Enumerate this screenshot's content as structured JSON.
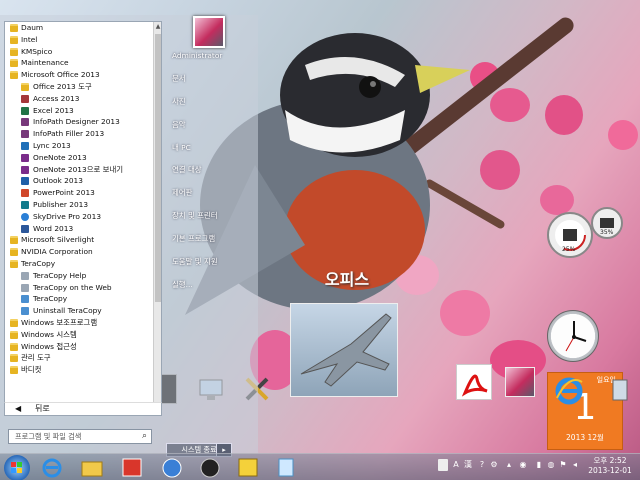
{
  "desktop": {
    "shortcut_label": "오피스"
  },
  "start_menu": {
    "programs": [
      {
        "label": "Daum"
      },
      {
        "label": "Intel"
      },
      {
        "label": "KMSpico"
      },
      {
        "label": "Maintenance"
      },
      {
        "label": "Microsoft Office 2013"
      },
      {
        "label": "Office 2013 도구"
      },
      {
        "label": "Access 2013"
      },
      {
        "label": "Excel 2013"
      },
      {
        "label": "InfoPath Designer 2013"
      },
      {
        "label": "InfoPath Filler 2013"
      },
      {
        "label": "Lync 2013"
      },
      {
        "label": "OneNote 2013"
      },
      {
        "label": "OneNote 2013으로 보내기"
      },
      {
        "label": "Outlook 2013"
      },
      {
        "label": "PowerPoint 2013"
      },
      {
        "label": "Publisher 2013"
      },
      {
        "label": "SkyDrive Pro 2013"
      },
      {
        "label": "Word 2013"
      },
      {
        "label": "Microsoft Silverlight"
      },
      {
        "label": "NVIDIA Corporation"
      },
      {
        "label": "TeraCopy"
      },
      {
        "label": "TeraCopy Help"
      },
      {
        "label": "TeraCopy on the Web"
      },
      {
        "label": "TeraCopy"
      },
      {
        "label": "Uninstall TeraCopy"
      },
      {
        "label": "Windows 보조프로그램"
      },
      {
        "label": "Windows 시스템"
      },
      {
        "label": "Windows 접근성"
      },
      {
        "label": "관리 도구"
      },
      {
        "label": "바디컷"
      }
    ],
    "back_label": "뒤로",
    "search_placeholder": "프로그램 및 파일 검색",
    "right_items": [
      "Administrator",
      "문서",
      "사진",
      "음악",
      "내 PC",
      "연결 대상",
      "제어판",
      "장치 및 프린터",
      "기본 프로그램",
      "도움말 및 지원",
      "실행..."
    ],
    "shutdown_label": "시스템 종료"
  },
  "gadgets": {
    "cpu_usage": "25%",
    "mem_usage": "35%",
    "calendar": {
      "weekday": "일요일",
      "day": "1",
      "month_year": "2013 12월"
    }
  },
  "tray": {
    "ime_mode": "A",
    "ime_hanja": "漢",
    "time": "오후 2:52",
    "date": "2013-12-01"
  }
}
